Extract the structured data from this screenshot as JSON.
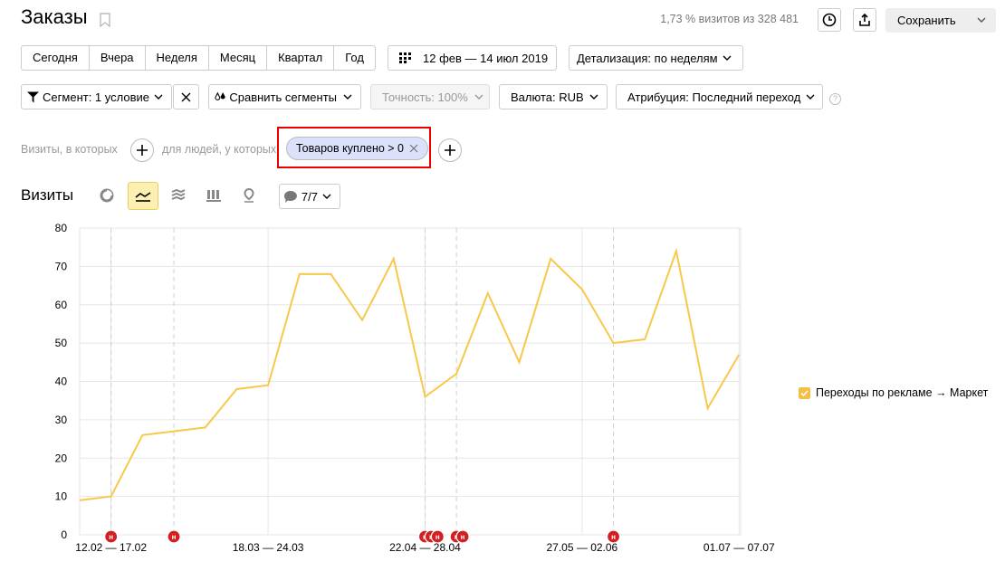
{
  "header": {
    "title": "Заказы",
    "stats": "1,73 % визитов из 328 481",
    "save_label": "Сохранить"
  },
  "periods": [
    "Сегодня",
    "Вчера",
    "Неделя",
    "Месяц",
    "Квартал",
    "Год"
  ],
  "date_range": "12 фев — 14 июл 2019",
  "detail": "Детализация: по неделям",
  "filters": {
    "segment": "Сегмент: 1 условие",
    "compare": "Сравнить сегменты",
    "accuracy": "Точность: 100%",
    "currency": "Валюта: RUB",
    "attribution": "Атрибуция: Последний переход"
  },
  "conditions": {
    "visits_label": "Визиты, в которых",
    "people_label": "для людей, у которых",
    "chip": "Товаров куплено > 0"
  },
  "chart_section": {
    "title": "Визиты",
    "annotations_label": "7/7"
  },
  "chart_data": {
    "type": "line",
    "ylabel": "",
    "ylim": [
      0,
      80
    ],
    "yticks": [
      "0",
      "10",
      "20",
      "30",
      "40",
      "50",
      "60",
      "70",
      "80"
    ],
    "xtick_labels": [
      "12.02 — 17.02",
      "18.03 — 24.03",
      "22.04 — 28.04",
      "27.05 — 02.06",
      "01.07 — 07.07"
    ],
    "xtick_indices": [
      1,
      6,
      11,
      16,
      21
    ],
    "series": [
      {
        "name": "Переходы по рекламе → Маркет",
        "color": "#f8c84a",
        "values": [
          9,
          10,
          26,
          27,
          28,
          38,
          39,
          68,
          68,
          56,
          72,
          36,
          42,
          63,
          45,
          72,
          64,
          50,
          51,
          74,
          33,
          47
        ]
      }
    ],
    "annotation_marker": "н",
    "annotation_indices": [
      1,
      3,
      11,
      11.2,
      11.4,
      12,
      12.2,
      17
    ],
    "legend_position": "right",
    "grid": true
  }
}
